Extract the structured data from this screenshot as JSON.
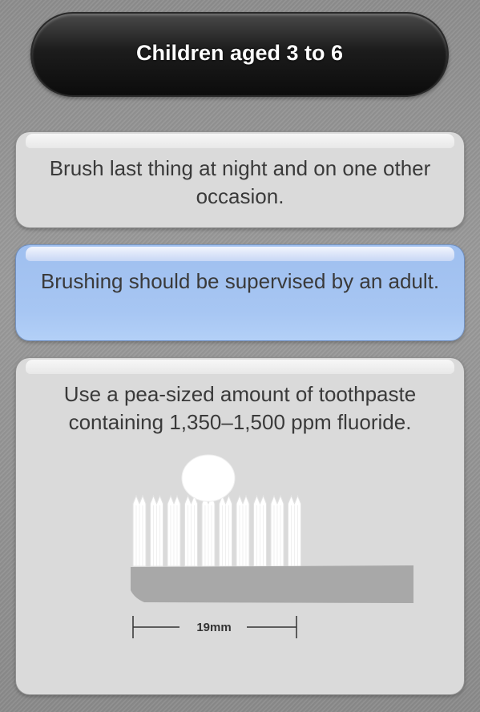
{
  "header": {
    "title": "Children aged 3 to 6"
  },
  "cards": [
    {
      "text": "Brush last thing at night and on one other occasion.",
      "style": "grey"
    },
    {
      "text": "Brushing should be supervised by an adult.",
      "style": "blue"
    },
    {
      "text": "Use a pea-sized amount of toothpaste containing 1,350–1,500 ppm fluoride.",
      "style": "grey"
    }
  ],
  "illustration": {
    "measurement_label": "19mm"
  },
  "colors": {
    "title_bar": "#111111",
    "card_grey": "#dadada",
    "card_blue": "#a7c6f3",
    "text": "#3a3a3a",
    "brush_handle": "#a8a8a8",
    "bristles": "#ffffff"
  }
}
